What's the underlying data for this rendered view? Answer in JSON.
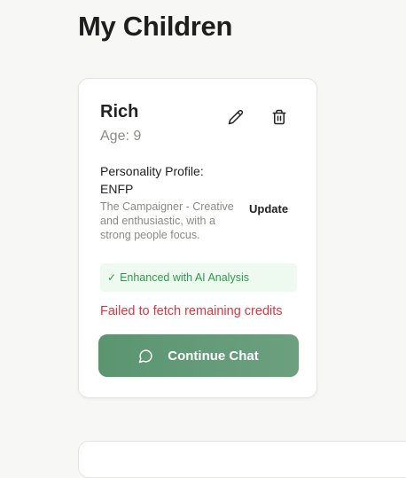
{
  "page": {
    "title": "My Children"
  },
  "child_card": {
    "name": "Rich",
    "age": "Age: 9",
    "profile_label": "Personality Profile:",
    "profile_type": "ENFP",
    "profile_description": "The Campaigner - Creative and enthusiastic, with a strong people focus.",
    "update_label": "Update",
    "ai_badge_check": "✓",
    "ai_badge_label": "Enhanced with AI Analysis",
    "credits_error": "Failed to fetch remaining credits",
    "chat_button_label": "Continue Chat",
    "icons": {
      "edit": "pencil-icon",
      "delete": "trash-icon",
      "chat": "chat-bubble-icon"
    }
  },
  "colors": {
    "accent": "#5a9570",
    "error": "#d9363e",
    "success": "#2f9a4e"
  }
}
